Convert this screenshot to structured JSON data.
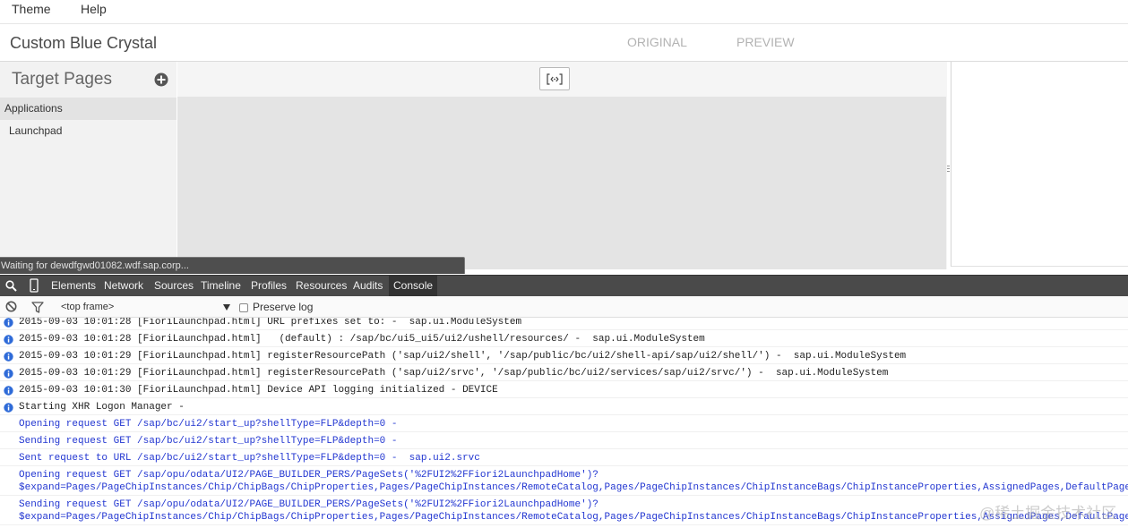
{
  "menu": {
    "items": [
      "Theme",
      "Help"
    ]
  },
  "header": {
    "theme_name": "Custom Blue Crystal",
    "view_tabs": [
      "ORIGINAL",
      "PREVIEW"
    ]
  },
  "target_pages": {
    "title": "Target Pages",
    "add_icon": "plus-circle-icon",
    "group_label": "Applications",
    "items": [
      "Launchpad"
    ]
  },
  "preview": {
    "toolbar_icon": "code-brackets-icon",
    "splitter_icon": "grip-icon"
  },
  "status_bubble": {
    "text": "Waiting for dewdfgwd01082.wdf.sap.corp..."
  },
  "devtools": {
    "toolbar_icons": [
      "search-icon",
      "device-mode-icon"
    ],
    "tabs": [
      "Elements",
      "Network",
      "Sources",
      "Timeline",
      "Profiles",
      "Resources",
      "Audits",
      "Console"
    ],
    "active_tab_index": 7,
    "console_toolbar": {
      "icons": [
        "clear-console-icon",
        "filter-icon",
        "dropdown-arrow-icon"
      ],
      "context": "<top frame>",
      "preserve_log": {
        "label": "Preserve log",
        "checked": false
      }
    },
    "messages": [
      {
        "icon": "info-icon",
        "color": "#222222",
        "lines": [
          "2015-09-03 10:01:28 [FioriLaunchpad.html] URL prefixes set to: -  sap.ui.ModuleSystem"
        ]
      },
      {
        "icon": "info-icon",
        "color": "#222222",
        "lines": [
          "2015-09-03 10:01:28 [FioriLaunchpad.html]   (default) : /sap/bc/ui5_ui5/ui2/ushell/resources/ -  sap.ui.ModuleSystem"
        ]
      },
      {
        "icon": "info-icon",
        "color": "#222222",
        "lines": [
          "2015-09-03 10:01:29 [FioriLaunchpad.html] registerResourcePath ('sap/ui2/shell', '/sap/public/bc/ui2/shell-api/sap/ui2/shell/') -  sap.ui.ModuleSystem"
        ]
      },
      {
        "icon": "info-icon",
        "color": "#222222",
        "lines": [
          "2015-09-03 10:01:29 [FioriLaunchpad.html] registerResourcePath ('sap/ui2/srvc', '/sap/public/bc/ui2/services/sap/ui2/srvc/') -  sap.ui.ModuleSystem"
        ]
      },
      {
        "icon": "info-icon",
        "color": "#222222",
        "lines": [
          "2015-09-03 10:01:30 [FioriLaunchpad.html] Device API logging initialized - DEVICE"
        ]
      },
      {
        "icon": "info-icon",
        "color": "#222222",
        "lines": [
          "Starting XHR Logon Manager -"
        ]
      },
      {
        "icon": "",
        "color": "#2236d1",
        "lines": [
          "Opening request GET /sap/bc/ui2/start_up?shellType=FLP&depth=0 -"
        ]
      },
      {
        "icon": "",
        "color": "#2236d1",
        "lines": [
          "Sending request GET /sap/bc/ui2/start_up?shellType=FLP&depth=0 -"
        ]
      },
      {
        "icon": "",
        "color": "#2236d1",
        "lines": [
          "Sent request to URL /sap/bc/ui2/start_up?shellType=FLP&depth=0 -  sap.ui2.srvc"
        ]
      },
      {
        "icon": "",
        "color": "#2236d1",
        "lines": [
          "Opening request GET /sap/opu/odata/UI2/PAGE_BUILDER_PERS/PageSets('%2FUI2%2FFiori2LaunchpadHome')?",
          "$expand=Pages/PageChipInstances/Chip/ChipBags/ChipProperties,Pages/PageChipInstances/RemoteCatalog,Pages/PageChipInstances/ChipInstanceBags/ChipInstanceProperties,AssignedPages,DefaultPage"
        ]
      },
      {
        "icon": "",
        "color": "#2236d1",
        "lines": [
          "Sending request GET /sap/opu/odata/UI2/PAGE_BUILDER_PERS/PageSets('%2FUI2%2FFiori2LaunchpadHome')?",
          "$expand=Pages/PageChipInstances/Chip/ChipBags/ChipProperties,Pages/PageChipInstances/RemoteCatalog,Pages/PageChipInstances/ChipInstanceBags/ChipInstanceProperties,AssignedPages,DefaultPage"
        ]
      }
    ]
  },
  "colors": {
    "info_icon": "#2f6bd8",
    "debug_text": "#2236d1",
    "devtools_toolbar": "#4a4a4a",
    "status_bubble": "#4e4e4e",
    "preview_canvas": "#e4e4e4"
  },
  "watermark": "@稀土掘金技术社区"
}
